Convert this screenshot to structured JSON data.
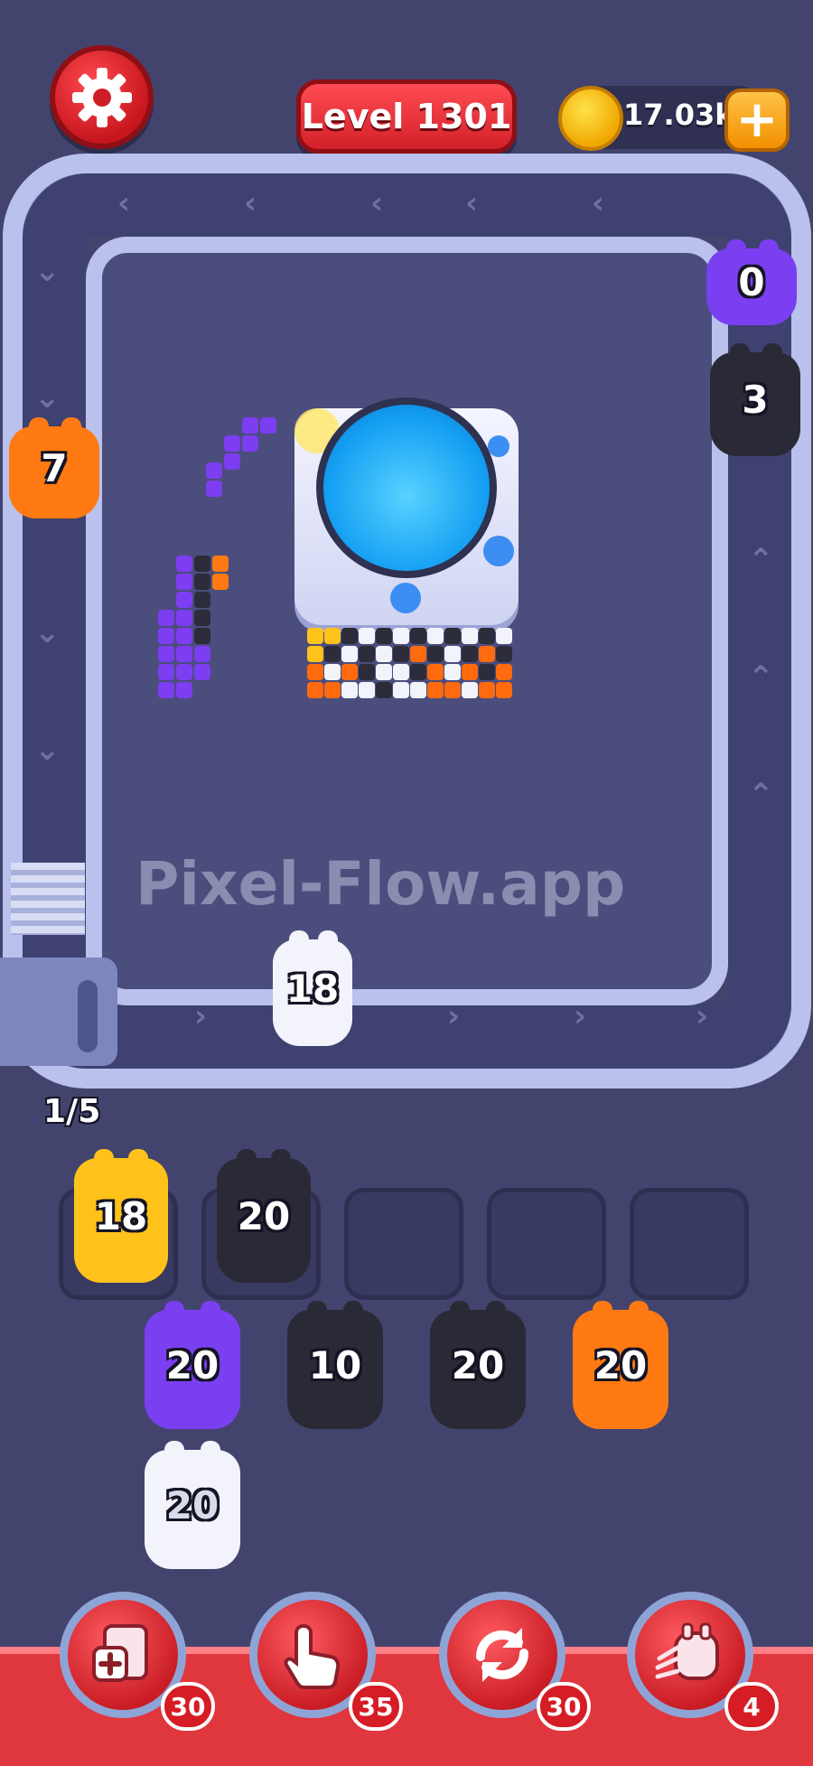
{
  "header": {
    "level_label": "Level 1301",
    "coins": "17.03k",
    "add_symbol": "+"
  },
  "watermark": "Pixel-Flow.app",
  "queue_counter": "1/5",
  "track_pigs": [
    {
      "value": "0",
      "color": "#7b3ff2"
    },
    {
      "value": "3",
      "color": "#2a2a36"
    },
    {
      "value": "7",
      "color": "#ff7a12"
    },
    {
      "value": "18",
      "color": "#f2f3fb"
    }
  ],
  "holding_slots": [
    {
      "value": "18",
      "color": "#ffc21a"
    },
    {
      "value": "20",
      "color": "#2a2a36"
    },
    {
      "value": "",
      "color": ""
    },
    {
      "value": "",
      "color": ""
    },
    {
      "value": "",
      "color": ""
    }
  ],
  "pig_columns": [
    [
      {
        "value": "20",
        "color": "#7b3ff2"
      },
      {
        "value": "20",
        "color": "#f2f3fb"
      }
    ],
    [
      {
        "value": "10",
        "color": "#2a2a36"
      }
    ],
    [
      {
        "value": "20",
        "color": "#2a2a36"
      }
    ],
    [
      {
        "value": "20",
        "color": "#ff7a12"
      }
    ]
  ],
  "powerups": [
    {
      "icon": "add-slot-icon",
      "count": "30"
    },
    {
      "icon": "hand-pointer-icon",
      "count": "35"
    },
    {
      "icon": "shuffle-icon",
      "count": "30"
    },
    {
      "icon": "pig-train-icon",
      "count": "4"
    }
  ],
  "colors": {
    "background": "#43446e",
    "track": "#b9c1ec",
    "accent_red": "#e0363e",
    "coin": "#ffc21a"
  }
}
